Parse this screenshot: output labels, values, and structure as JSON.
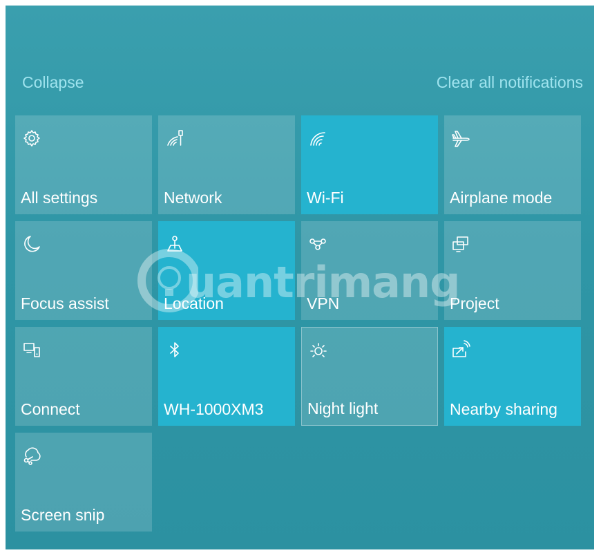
{
  "header": {
    "collapse_label": "Collapse",
    "clear_label": "Clear all notifications"
  },
  "tiles": [
    {
      "label": "All settings",
      "icon": "gear-icon",
      "state": "off"
    },
    {
      "label": "Network",
      "icon": "network-icon",
      "state": "off"
    },
    {
      "label": "Wi-Fi",
      "icon": "wifi-icon",
      "state": "on"
    },
    {
      "label": "Airplane mode",
      "icon": "airplane-icon",
      "state": "off"
    },
    {
      "label": "Focus assist",
      "icon": "moon-icon",
      "state": "off"
    },
    {
      "label": "Location",
      "icon": "location-icon",
      "state": "on"
    },
    {
      "label": "VPN",
      "icon": "vpn-icon",
      "state": "off"
    },
    {
      "label": "Project",
      "icon": "project-icon",
      "state": "off"
    },
    {
      "label": "Connect",
      "icon": "connect-icon",
      "state": "off"
    },
    {
      "label": "WH-1000XM3",
      "icon": "bluetooth-icon",
      "state": "on"
    },
    {
      "label": "Night light",
      "icon": "sun-icon",
      "state": "off"
    },
    {
      "label": "Nearby sharing",
      "icon": "nearby-sharing-icon",
      "state": "on"
    },
    {
      "label": "Screen snip",
      "icon": "screen-snip-icon",
      "state": "off"
    }
  ],
  "watermark": {
    "text": "uantrimang"
  },
  "colors": {
    "panel_bg": "#2f96a6",
    "tile_on": "#25b3cf",
    "tile_off": "rgba(255,255,255,0.16)",
    "link": "#9fe3ee"
  }
}
